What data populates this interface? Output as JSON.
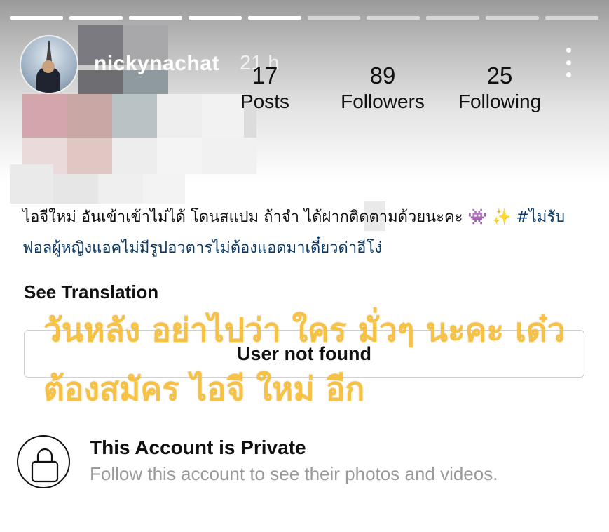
{
  "story": {
    "segments": [
      true,
      true,
      true,
      true,
      true,
      false,
      false,
      false,
      false,
      false
    ],
    "username": "nickynachat",
    "time_ago": "21 h",
    "more_icon": "more-vertical-icon"
  },
  "profile": {
    "stats": [
      {
        "value": "17",
        "label": "Posts"
      },
      {
        "value": "89",
        "label": "Followers"
      },
      {
        "value": "25",
        "label": "Following"
      }
    ],
    "bio_text": "ไอจีใหม่ อันเข้าเข้าไม่ได้ โดนสแปม ถ้าจำ ได้ฝากติดตามด้วยนะคะ 👾 ✨ ",
    "bio_hashtag": "#ไม่รับฟอลผู้หญิงแอคไม่มีรูปอวตารไม่ต้องแอดมาเดี๋ยวด่าอีโง่",
    "see_translation": "See Translation",
    "follow_button": "User not found"
  },
  "private": {
    "title": "This Account is Private",
    "subtitle": "Follow this account to see their photos and videos.",
    "icon": "lock-icon"
  },
  "overlay_text": "วันหลัง อย่าไปว่า ใคร มั่วๆ นะคะ เด๋ว ต้องสมัคร ไอจี ใหม่ อีก",
  "colors": {
    "overlay": "#f6c245",
    "hashtag": "#0d3b66",
    "muted": "#9a9a9a"
  }
}
